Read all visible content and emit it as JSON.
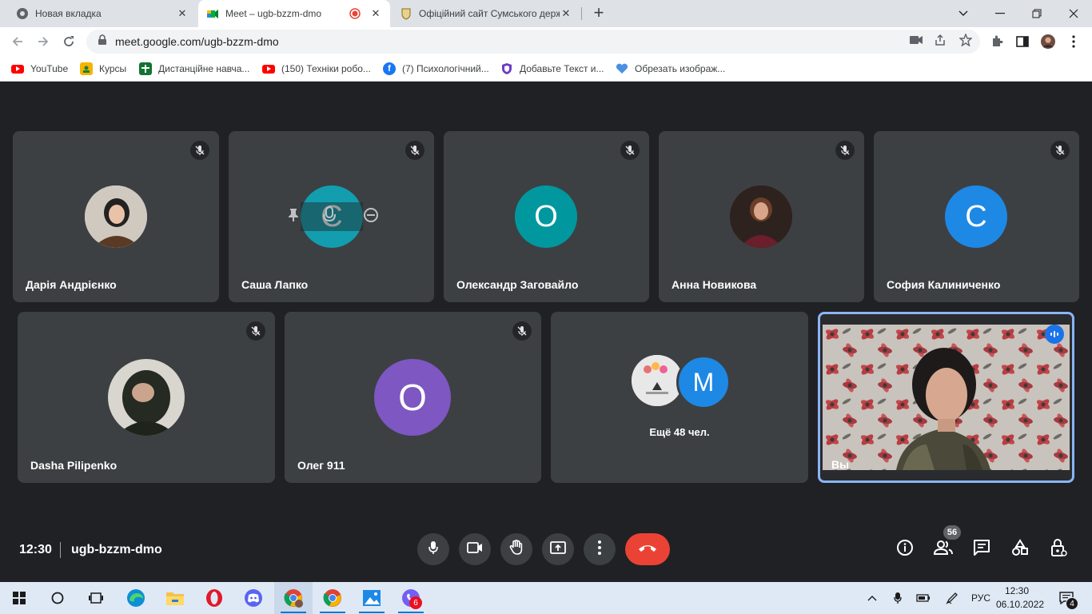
{
  "browser": {
    "tabs": [
      {
        "title": "Новая вкладка",
        "icon": "chrome-icon",
        "active": false
      },
      {
        "title": "Meet – ugb-bzzm-dmo",
        "icon": "meet-icon",
        "active": true,
        "recording_icon": "record-dot-icon"
      },
      {
        "title": "Офіційний сайт Сумського держ",
        "icon": "university-crest-icon",
        "active": false
      }
    ],
    "url": "meet.google.com/ugb-bzzm-dmo",
    "bookmarks": [
      {
        "label": "YouTube",
        "icon": "youtube-icon"
      },
      {
        "label": "Курсы",
        "icon": "classroom-icon"
      },
      {
        "label": "Дистанційне навча...",
        "icon": "plus-cross-icon"
      },
      {
        "label": "(150) Техніки робо...",
        "icon": "youtube-icon"
      },
      {
        "label": "(7) Психологічний...",
        "icon": "facebook-icon"
      },
      {
        "label": "Добавьте Текст и...",
        "icon": "shield-icon"
      },
      {
        "label": "Обрезать изображ...",
        "icon": "heart-icon"
      }
    ]
  },
  "meet": {
    "participants_row1": [
      {
        "name": "Дарія Андрієнко",
        "avatar": "photo",
        "muted": true
      },
      {
        "name": "Саша Лапко",
        "avatar": "letter",
        "letter": "С",
        "avatar_color": "#129eaf",
        "muted": true
      },
      {
        "name": "Олександр Заговайло",
        "avatar": "letter",
        "letter": "О",
        "avatar_color": "#00989e",
        "muted": true
      },
      {
        "name": "Анна Новикова",
        "avatar": "photo",
        "muted": true
      },
      {
        "name": "София Калиниченко",
        "avatar": "letter",
        "letter": "С",
        "avatar_color": "#1e88e5",
        "muted": true
      }
    ],
    "participants_row2": [
      {
        "name": "Dasha Pilipenko",
        "avatar": "photo",
        "muted": true
      },
      {
        "name": "Олег 911",
        "avatar": "letter",
        "letter": "О",
        "avatar_color": "#7e57c2",
        "muted": true
      }
    ],
    "more": {
      "label": "Ещё 48 чел.",
      "letter": "M",
      "avatar_color": "#1e88e5"
    },
    "self": {
      "name": "Вы",
      "speaking": true
    },
    "clock": "12:30",
    "meeting_code": "ugb-bzzm-dmo",
    "participants_count": "56",
    "controls": [
      "microphone-icon",
      "camera-icon",
      "raise-hand-icon",
      "present-screen-icon",
      "more-options-icon",
      "end-call-icon"
    ],
    "right_controls": [
      "info-icon",
      "people-icon",
      "chat-icon",
      "activities-icon",
      "host-controls-icon"
    ]
  },
  "taskbar": {
    "apps": [
      "windows-start-icon",
      "search-icon",
      "task-view-icon",
      "edge-icon",
      "file-explorer-icon",
      "opera-icon",
      "discord-icon",
      "chrome-icon",
      "chrome-icon",
      "photos-icon",
      "viber-icon"
    ],
    "viber_badge": "6",
    "language": "РУС",
    "time": "12:30",
    "date": "06.10.2022",
    "notifications": "4"
  },
  "colors": {
    "meet_background": "#202124",
    "tile_background": "#3c4043",
    "self_border": "#8ab4f8",
    "end_call": "#ea4335"
  }
}
